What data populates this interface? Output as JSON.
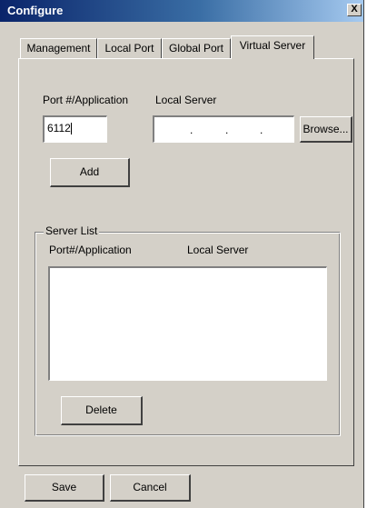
{
  "window": {
    "title": "Configure",
    "close_glyph": "X"
  },
  "tabs": [
    {
      "label": "Management",
      "active": false
    },
    {
      "label": "Local Port",
      "active": false
    },
    {
      "label": "Global Port",
      "active": false
    },
    {
      "label": "Virtual Server",
      "active": true
    }
  ],
  "virtual_server": {
    "port_label": "Port #/Application",
    "port_value": "6112",
    "local_server_label": "Local Server",
    "ip_dots": [
      ".",
      ".",
      "."
    ],
    "browse_label": "Browse...",
    "add_label": "Add",
    "server_list": {
      "title": "Server List",
      "col_port": "Port#/Application",
      "col_server": "Local Server",
      "items": []
    },
    "delete_label": "Delete"
  },
  "footer": {
    "save_label": "Save",
    "cancel_label": "Cancel"
  }
}
